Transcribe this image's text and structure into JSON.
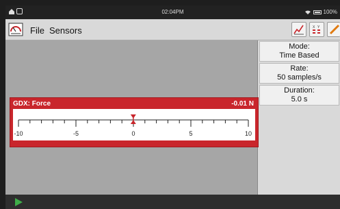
{
  "status": {
    "time": "02:04PM",
    "battery": "100%"
  },
  "menu": {
    "file": "File",
    "sensors": "Sensors"
  },
  "panel": {
    "mode_label": "Mode:",
    "mode_value": "Time Based",
    "rate_label": "Rate:",
    "rate_value": "50 samples/s",
    "duration_label": "Duration:",
    "duration_value": "5.0 s"
  },
  "meter": {
    "name": "GDX: Force",
    "value": "-0.01 N",
    "reading": -0.01,
    "scale_min": -10,
    "scale_max": 10,
    "tick_labels": [
      "-10",
      "-5",
      "0",
      "5",
      "10"
    ],
    "accent": "#c9262c"
  },
  "icons": [
    "home-icon",
    "wifi-icon",
    "battery-icon",
    "gauge-icon",
    "graph-view-icon",
    "table-view-icon",
    "annotate-icon",
    "play-icon"
  ]
}
